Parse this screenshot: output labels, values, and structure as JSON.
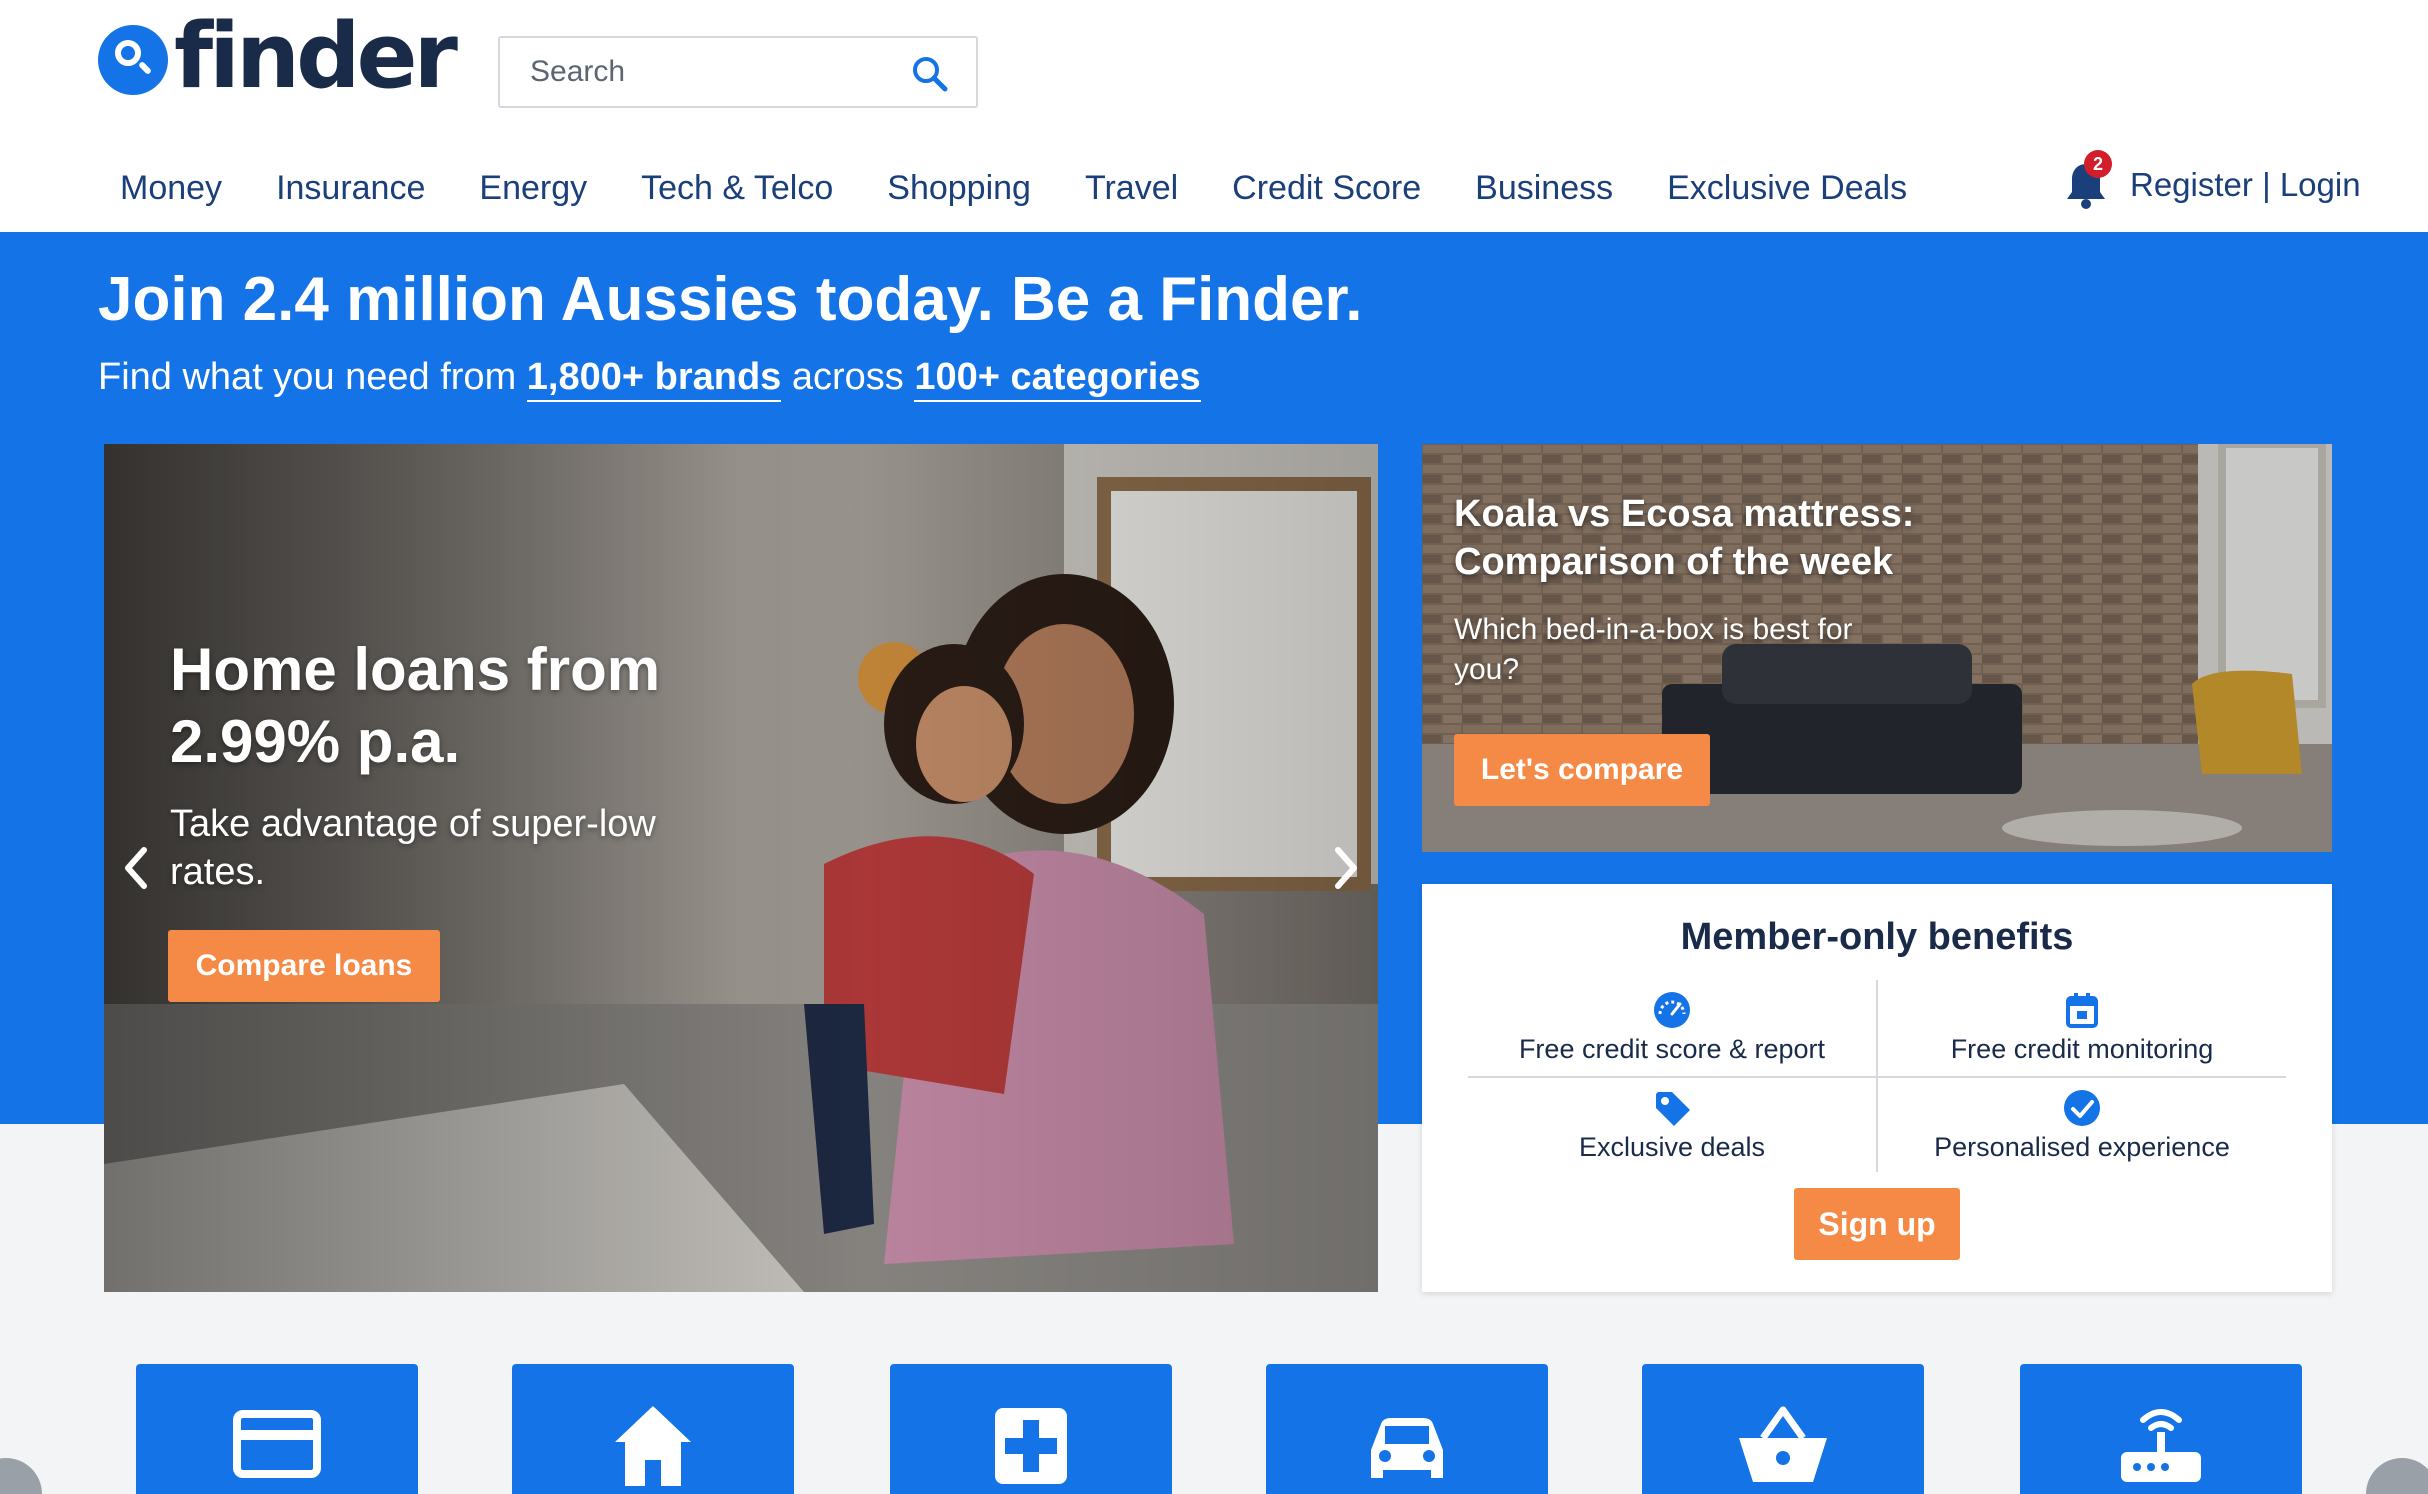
{
  "brand": {
    "logo_text": "finder",
    "accent": "#1473e6",
    "cta": "#f58a47"
  },
  "search": {
    "placeholder": "Search",
    "icon": "search-icon"
  },
  "nav": {
    "items": [
      "Money",
      "Insurance",
      "Energy",
      "Tech & Telco",
      "Shopping",
      "Travel",
      "Credit Score",
      "Business",
      "Exclusive Deals"
    ],
    "notifications_count": "2",
    "register": "Register",
    "separator": "|",
    "login": "Login"
  },
  "hero": {
    "headline": "Join 2.4 million Aussies today. Be a Finder.",
    "sub_prefix": "Find what you need from ",
    "brands_link": "1,800+ brands",
    "sub_middle": " across ",
    "categories_link": "100+ categories"
  },
  "carousel": {
    "title": "Home loans from 2.99% p.a.",
    "description": "Take advantage of super-low rates.",
    "button": "Compare loans"
  },
  "promo": {
    "title": "Koala vs Ecosa mattress: Comparison of the week",
    "description": "Which bed-in-a-box is best for you?",
    "button": "Let's compare"
  },
  "benefits": {
    "title": "Member-only benefits",
    "items": [
      {
        "label": "Free credit score & report",
        "icon": "gauge-icon"
      },
      {
        "label": "Free credit monitoring",
        "icon": "calendar-icon"
      },
      {
        "label": "Exclusive deals",
        "icon": "tag-icon"
      },
      {
        "label": "Personalised experience",
        "icon": "check-circle-icon"
      }
    ],
    "button": "Sign up"
  },
  "categories": [
    {
      "icon": "credit-card-icon"
    },
    {
      "icon": "home-icon"
    },
    {
      "icon": "health-cross-icon"
    },
    {
      "icon": "car-icon"
    },
    {
      "icon": "shopping-basket-icon"
    },
    {
      "icon": "router-icon"
    }
  ]
}
